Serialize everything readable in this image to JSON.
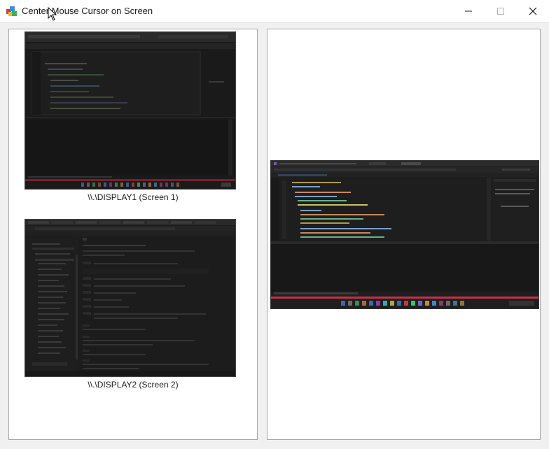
{
  "window": {
    "title": "Center Mouse Cursor on Screen"
  },
  "displays": [
    {
      "label": "\\\\.\\DISPLAY1 (Screen 1)"
    },
    {
      "label": "\\\\.\\DISPLAY2 (Screen 2)"
    }
  ],
  "colors": {
    "accent_red": "#c4314b",
    "taskbar": "#1f1f1f",
    "editor_bg": "#1e1e1e"
  }
}
